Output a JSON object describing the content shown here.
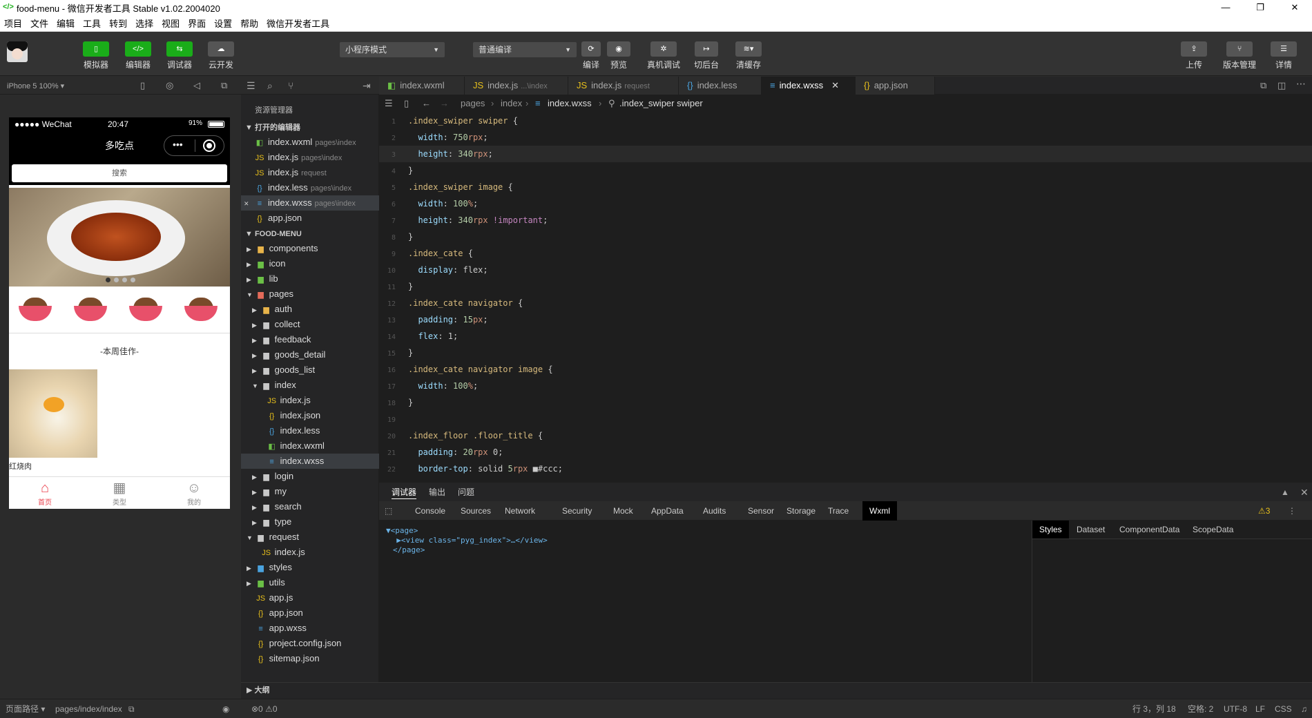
{
  "window": {
    "title": "food-menu - 微信开发者工具 Stable v1.02.2004020",
    "icon": "code-icon",
    "controls": [
      "—",
      "❐",
      "✕"
    ]
  },
  "menu": [
    "项目",
    "文件",
    "编辑",
    "工具",
    "转到",
    "选择",
    "视图",
    "界面",
    "设置",
    "帮助",
    "微信开发者工具"
  ],
  "toolbar": {
    "left_buttons": [
      {
        "label": "模拟器",
        "icon": "phone-icon"
      },
      {
        "label": "编辑器",
        "icon": "code-icon"
      },
      {
        "label": "调试器",
        "icon": "debug-icon"
      },
      {
        "label": "云开发",
        "icon": "cloud-icon"
      }
    ],
    "mode_select": "小程序模式",
    "compile_select": "普通编译",
    "mid_buttons": [
      {
        "label": "编译",
        "icon": "refresh-icon"
      },
      {
        "label": "预览",
        "icon": "eye-icon"
      },
      {
        "label": "真机调试",
        "icon": "bug-icon"
      },
      {
        "label": "切后台",
        "icon": "switch-icon"
      },
      {
        "label": "清缓存",
        "icon": "layers-icon"
      }
    ],
    "right_buttons": [
      {
        "label": "上传",
        "icon": "upload-icon"
      },
      {
        "label": "版本管理",
        "icon": "branch-icon"
      },
      {
        "label": "详情",
        "icon": "menu-icon"
      }
    ]
  },
  "simulator": {
    "device": "iPhone 5 100% ▾",
    "status": {
      "carrier": "●●●●● WeChat",
      "time": "20:47",
      "battery": "91%"
    },
    "nav_title": "多吃点",
    "search_placeholder": "搜索",
    "floor_title": "-本周佳作-",
    "goods_name": "红烧肉",
    "tabs": [
      {
        "label": "首页",
        "icon": "home-icon",
        "active": true
      },
      {
        "label": "类型",
        "icon": "grid-icon",
        "active": false
      },
      {
        "label": "我的",
        "icon": "user-icon",
        "active": false
      }
    ]
  },
  "explorer": {
    "title": "资源管理器",
    "open_editors_label": "打开的编辑器",
    "open_editors": [
      {
        "name": "index.wxml",
        "sub": "pages\\index",
        "type": "wxml"
      },
      {
        "name": "index.js",
        "sub": "pages\\index",
        "type": "js"
      },
      {
        "name": "index.js",
        "sub": "request",
        "type": "js"
      },
      {
        "name": "index.less",
        "sub": "pages\\index",
        "type": "less"
      },
      {
        "name": "index.wxss",
        "sub": "pages\\index",
        "type": "wxss",
        "selected": true
      },
      {
        "name": "app.json",
        "sub": "",
        "type": "json"
      }
    ],
    "project_label": "FOOD-MENU",
    "tree": [
      {
        "name": "components",
        "depth": 1,
        "arrow": "▶",
        "icon": "folder-y"
      },
      {
        "name": "icon",
        "depth": 1,
        "arrow": "▶",
        "icon": "folder-g"
      },
      {
        "name": "lib",
        "depth": 1,
        "arrow": "▶",
        "icon": "folder-g"
      },
      {
        "name": "pages",
        "depth": 1,
        "arrow": "▼",
        "icon": "folder-r"
      },
      {
        "name": "auth",
        "depth": 2,
        "arrow": "▶",
        "icon": "folder-y"
      },
      {
        "name": "collect",
        "depth": 2,
        "arrow": "▶",
        "icon": "folder"
      },
      {
        "name": "feedback",
        "depth": 2,
        "arrow": "▶",
        "icon": "folder"
      },
      {
        "name": "goods_detail",
        "depth": 2,
        "arrow": "▶",
        "icon": "folder"
      },
      {
        "name": "goods_list",
        "depth": 2,
        "arrow": "▶",
        "icon": "folder"
      },
      {
        "name": "index",
        "depth": 2,
        "arrow": "▼",
        "icon": "folder"
      },
      {
        "name": "index.js",
        "depth": 3,
        "arrow": "",
        "icon": "js"
      },
      {
        "name": "index.json",
        "depth": 3,
        "arrow": "",
        "icon": "json"
      },
      {
        "name": "index.less",
        "depth": 3,
        "arrow": "",
        "icon": "less"
      },
      {
        "name": "index.wxml",
        "depth": 3,
        "arrow": "",
        "icon": "wxml"
      },
      {
        "name": "index.wxss",
        "depth": 3,
        "arrow": "",
        "icon": "wxss",
        "selected": true
      },
      {
        "name": "login",
        "depth": 2,
        "arrow": "▶",
        "icon": "folder"
      },
      {
        "name": "my",
        "depth": 2,
        "arrow": "▶",
        "icon": "folder"
      },
      {
        "name": "search",
        "depth": 2,
        "arrow": "▶",
        "icon": "folder"
      },
      {
        "name": "type",
        "depth": 2,
        "arrow": "▶",
        "icon": "folder"
      },
      {
        "name": "request",
        "depth": 1,
        "arrow": "▼",
        "icon": "folder"
      },
      {
        "name": "index.js",
        "depth": 2,
        "arrow": "",
        "icon": "js"
      },
      {
        "name": "styles",
        "depth": 1,
        "arrow": "▶",
        "icon": "folder-b"
      },
      {
        "name": "utils",
        "depth": 1,
        "arrow": "▶",
        "icon": "folder-g"
      },
      {
        "name": "app.js",
        "depth": 1,
        "arrow": "",
        "icon": "js"
      },
      {
        "name": "app.json",
        "depth": 1,
        "arrow": "",
        "icon": "json"
      },
      {
        "name": "app.wxss",
        "depth": 1,
        "arrow": "",
        "icon": "wxss"
      },
      {
        "name": "project.config.json",
        "depth": 1,
        "arrow": "",
        "icon": "json"
      },
      {
        "name": "sitemap.json",
        "depth": 1,
        "arrow": "",
        "icon": "json"
      }
    ],
    "outline_label": "大纲"
  },
  "editor": {
    "tabs": [
      {
        "name": "index.wxml",
        "sub": "",
        "type": "wxml"
      },
      {
        "name": "index.js",
        "sub": "...\\index",
        "type": "js"
      },
      {
        "name": "index.js",
        "sub": "request",
        "type": "js"
      },
      {
        "name": "index.less",
        "sub": "",
        "type": "less"
      },
      {
        "name": "index.wxss",
        "sub": "",
        "type": "wxss",
        "active": true
      },
      {
        "name": "app.json",
        "sub": "",
        "type": "json"
      }
    ],
    "breadcrumb": [
      "pages",
      "index",
      "index.wxss",
      ".index_swiper swiper"
    ],
    "code": [
      ".index_swiper swiper {",
      "  width: 750rpx;",
      "  height: 340rpx;",
      "}",
      ".index_swiper image {",
      "  width: 100%;",
      "  height: 340rpx !important;",
      "}",
      ".index_cate {",
      "  display: flex;",
      "}",
      ".index_cate navigator {",
      "  padding: 15px;",
      "  flex: 1;",
      "}",
      ".index_cate navigator image {",
      "  width: 100%;",
      "}",
      "",
      ".index_floor .floor_title{",
      "  padding: 20rpx 0;",
      "  border-top: solid 5rpx ■#ccc;"
    ]
  },
  "debugger": {
    "top_tabs": [
      "调试器",
      "输出",
      "问题"
    ],
    "tabs": [
      "Console",
      "Sources",
      "Network",
      "Security",
      "Mock",
      "AppData",
      "Audits",
      "Sensor",
      "Storage",
      "Trace",
      "Wxml"
    ],
    "active_tab": "Wxml",
    "warnings": "⚠3",
    "dom": [
      "▼<page>",
      "  ▶<view class=\"pyg_index\">…</view>",
      "</page>"
    ],
    "side_tabs": [
      "Styles",
      "Dataset",
      "ComponentData",
      "ScopeData"
    ]
  },
  "statusbar": {
    "path_label": "页面路径 ▾",
    "path": "pages/index/index",
    "problems": "⊗0 ⚠0",
    "position": "行 3，列 18",
    "spaces": "空格: 2",
    "encoding": "UTF-8",
    "eol": "LF",
    "lang": "CSS"
  }
}
